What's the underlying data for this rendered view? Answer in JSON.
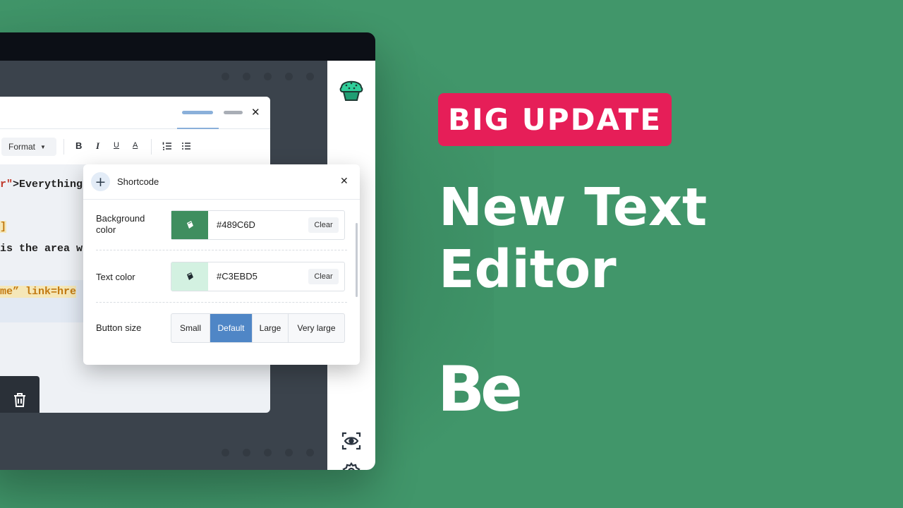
{
  "editor": {
    "toolbar": {
      "format_label": "Format",
      "bold_label": "B",
      "italic_label": "I",
      "underline_label": "U",
      "font_color_label": "A"
    },
    "code_lines": {
      "line1_tag": "r\"",
      "line1_text": ">Everything",
      "line2_text": "]",
      "line3_text": "is the area w",
      "line4_text": " me” link=hre"
    }
  },
  "shortcode_popup": {
    "title": "Shortcode",
    "background_color": {
      "label": "Background color",
      "value": "#489C6D",
      "swatch_color": "#3f8e5f",
      "clear_label": "Clear"
    },
    "text_color": {
      "label": "Text color",
      "value": "#C3EBD5",
      "swatch_color": "#d3f1e1",
      "clear_label": "Clear"
    },
    "button_size": {
      "label": "Button size",
      "options": [
        "Small",
        "Default",
        "Large",
        "Very large"
      ],
      "selected": "Default"
    }
  },
  "promo": {
    "badge": "BIG UPDATE",
    "headline_line1": "New Text",
    "headline_line2": "Editor",
    "brand": "Be"
  },
  "colors": {
    "background": "#41966a",
    "badge": "#e61e58",
    "accent_blue": "#4f86c6"
  }
}
